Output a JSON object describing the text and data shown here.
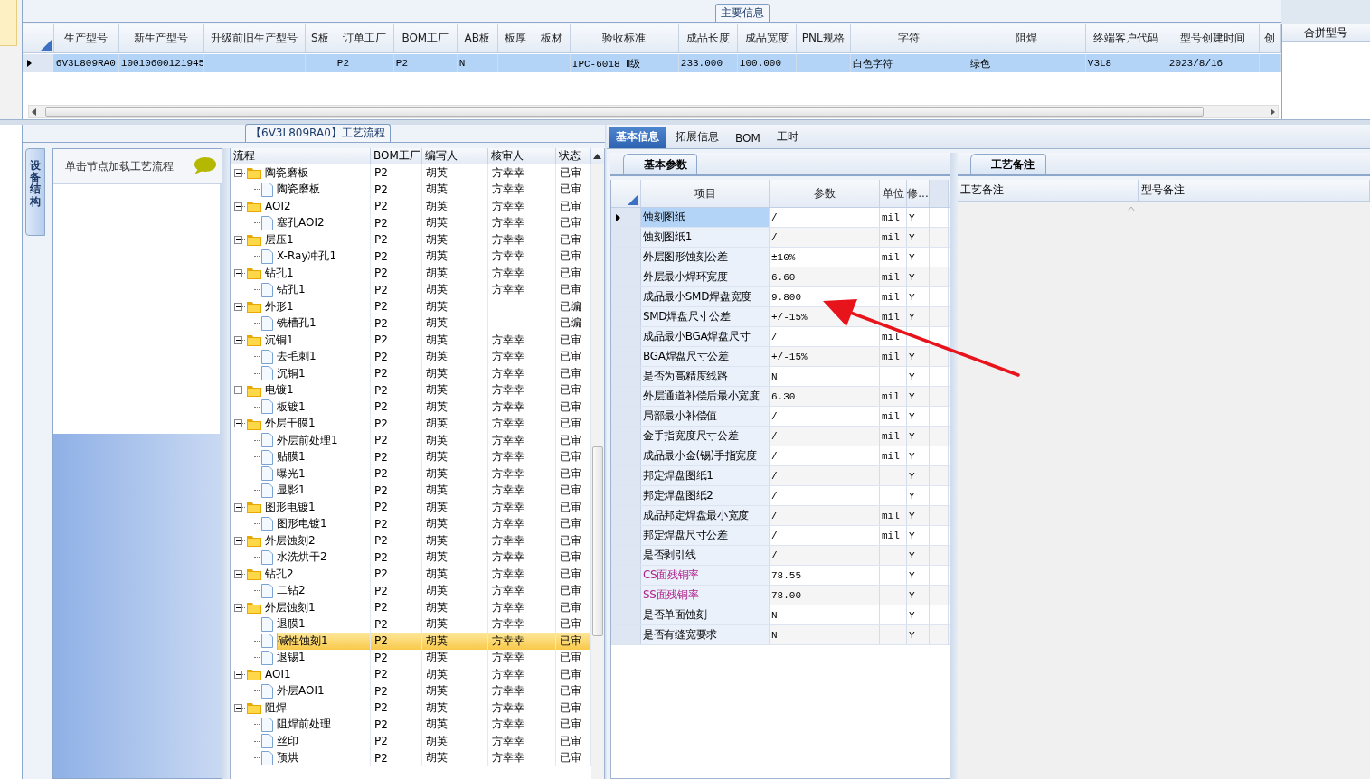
{
  "main_info": {
    "title": "主要信息",
    "columns": [
      "生产型号",
      "新生产型号",
      "升级前旧生产型号",
      "S板",
      "订单工厂",
      "BOM工厂",
      "AB板",
      "板厚",
      "板材",
      "验收标准",
      "成品长度",
      "成品宽度",
      "PNL规格",
      "字符",
      "阻焊",
      "终端客户代码",
      "型号创建时间",
      "创"
    ],
    "rows": [
      {
        "selected": true,
        "cells": [
          "6V3L809RA0",
          "10010600121945",
          null,
          null,
          "P2",
          "P2",
          "N",
          null,
          null,
          "IPC-6018 Ⅱ级",
          "233.000",
          "100.000",
          null,
          "白色字符",
          "绿色",
          "V3L8",
          "2023/8/16",
          null
        ]
      }
    ]
  },
  "merge_panel": {
    "title": "合拼型号"
  },
  "flow": {
    "title": "【6V3L809RA0】工艺流程",
    "side_tab": "设备结构",
    "hint": "单击节点加载工艺流程",
    "columns": [
      "流程",
      "BOM工厂",
      "编写人",
      "核审人",
      "状态"
    ],
    "nodes": [
      {
        "kind": "folder",
        "label": "陶瓷磨板",
        "bom": "P2",
        "writer": "胡英",
        "reviewer": "方幸幸",
        "status": "已审",
        "selected": false,
        "expanded": true,
        "children": [
          {
            "kind": "file",
            "label": "陶瓷磨板",
            "bom": "P2",
            "writer": "胡英",
            "reviewer": "方幸幸",
            "status": "已审",
            "selected": false
          }
        ]
      },
      {
        "kind": "folder",
        "label": "AOI2",
        "bom": "P2",
        "writer": "胡英",
        "reviewer": "方幸幸",
        "status": "已审",
        "selected": false,
        "expanded": true,
        "children": [
          {
            "kind": "file",
            "label": "塞孔AOI2",
            "bom": "P2",
            "writer": "胡英",
            "reviewer": "方幸幸",
            "status": "已审",
            "selected": false
          }
        ]
      },
      {
        "kind": "folder",
        "label": "层压1",
        "bom": "P2",
        "writer": "胡英",
        "reviewer": "方幸幸",
        "status": "已审",
        "selected": false,
        "expanded": true,
        "children": [
          {
            "kind": "file",
            "label": "X-Ray冲孔1",
            "bom": "P2",
            "writer": "胡英",
            "reviewer": "方幸幸",
            "status": "已审",
            "selected": false
          }
        ]
      },
      {
        "kind": "folder",
        "label": "钻孔1",
        "bom": "P2",
        "writer": "胡英",
        "reviewer": "方幸幸",
        "status": "已审",
        "selected": false,
        "expanded": true,
        "children": [
          {
            "kind": "file",
            "label": "钻孔1",
            "bom": "P2",
            "writer": "胡英",
            "reviewer": "方幸幸",
            "status": "已审",
            "selected": false
          }
        ]
      },
      {
        "kind": "folder",
        "label": "外形1",
        "bom": "P2",
        "writer": "胡英",
        "status": "已编",
        "selected": false,
        "expanded": true,
        "children": [
          {
            "kind": "file",
            "label": "铣槽孔1",
            "bom": "P2",
            "writer": "胡英",
            "status": "已编",
            "selected": false
          }
        ]
      },
      {
        "kind": "folder",
        "label": "沉铜1",
        "bom": "P2",
        "writer": "胡英",
        "reviewer": "方幸幸",
        "status": "已审",
        "selected": false,
        "expanded": true,
        "children": [
          {
            "kind": "file",
            "label": "去毛刺1",
            "bom": "P2",
            "writer": "胡英",
            "reviewer": "方幸幸",
            "status": "已审",
            "selected": false
          },
          {
            "kind": "file",
            "label": "沉铜1",
            "bom": "P2",
            "writer": "胡英",
            "reviewer": "方幸幸",
            "status": "已审",
            "selected": false
          }
        ]
      },
      {
        "kind": "folder",
        "label": "电镀1",
        "bom": "P2",
        "writer": "胡英",
        "reviewer": "方幸幸",
        "status": "已审",
        "selected": false,
        "expanded": true,
        "children": [
          {
            "kind": "file",
            "label": "板镀1",
            "bom": "P2",
            "writer": "胡英",
            "reviewer": "方幸幸",
            "status": "已审",
            "selected": false
          }
        ]
      },
      {
        "kind": "folder",
        "label": "外层干膜1",
        "bom": "P2",
        "writer": "胡英",
        "reviewer": "方幸幸",
        "status": "已审",
        "selected": false,
        "expanded": true,
        "children": [
          {
            "kind": "file",
            "label": "外层前处理1",
            "bom": "P2",
            "writer": "胡英",
            "reviewer": "方幸幸",
            "status": "已审",
            "selected": false
          },
          {
            "kind": "file",
            "label": "贴膜1",
            "bom": "P2",
            "writer": "胡英",
            "reviewer": "方幸幸",
            "status": "已审",
            "selected": false
          },
          {
            "kind": "file",
            "label": "曝光1",
            "bom": "P2",
            "writer": "胡英",
            "reviewer": "方幸幸",
            "status": "已审",
            "selected": false
          },
          {
            "kind": "file",
            "label": "显影1",
            "bom": "P2",
            "writer": "胡英",
            "reviewer": "方幸幸",
            "status": "已审",
            "selected": false
          }
        ]
      },
      {
        "kind": "folder",
        "label": "图形电镀1",
        "bom": "P2",
        "writer": "胡英",
        "reviewer": "方幸幸",
        "status": "已审",
        "selected": false,
        "expanded": true,
        "children": [
          {
            "kind": "file",
            "label": "图形电镀1",
            "bom": "P2",
            "writer": "胡英",
            "reviewer": "方幸幸",
            "status": "已审",
            "selected": false
          }
        ]
      },
      {
        "kind": "folder",
        "label": "外层蚀刻2",
        "bom": "P2",
        "writer": "胡英",
        "reviewer": "方幸幸",
        "status": "已审",
        "selected": false,
        "expanded": true,
        "children": [
          {
            "kind": "file",
            "label": "水洗烘干2",
            "bom": "P2",
            "writer": "胡英",
            "reviewer": "方幸幸",
            "status": "已审",
            "selected": false
          }
        ]
      },
      {
        "kind": "folder",
        "label": "钻孔2",
        "bom": "P2",
        "writer": "胡英",
        "reviewer": "方幸幸",
        "status": "已审",
        "selected": false,
        "expanded": true,
        "children": [
          {
            "kind": "file",
            "label": "二钻2",
            "bom": "P2",
            "writer": "胡英",
            "reviewer": "方幸幸",
            "status": "已审",
            "selected": false
          }
        ]
      },
      {
        "kind": "folder",
        "label": "外层蚀刻1",
        "bom": "P2",
        "writer": "胡英",
        "reviewer": "方幸幸",
        "status": "已审",
        "selected": false,
        "expanded": true,
        "children": [
          {
            "kind": "file",
            "label": "退膜1",
            "bom": "P2",
            "writer": "胡英",
            "reviewer": "方幸幸",
            "status": "已审",
            "selected": false
          },
          {
            "kind": "file",
            "label": "碱性蚀刻1",
            "bom": "P2",
            "writer": "胡英",
            "reviewer": "方幸幸",
            "status": "已审",
            "selected": true
          },
          {
            "kind": "file",
            "label": "退锡1",
            "bom": "P2",
            "writer": "胡英",
            "reviewer": "方幸幸",
            "status": "已审",
            "selected": false
          }
        ]
      },
      {
        "kind": "folder",
        "label": "AOI1",
        "bom": "P2",
        "writer": "胡英",
        "reviewer": "方幸幸",
        "status": "已审",
        "selected": false,
        "expanded": true,
        "children": [
          {
            "kind": "file",
            "label": "外层AOI1",
            "bom": "P2",
            "writer": "胡英",
            "reviewer": "方幸幸",
            "status": "已审",
            "selected": false
          }
        ]
      },
      {
        "kind": "folder",
        "label": "阻焊",
        "bom": "P2",
        "writer": "胡英",
        "reviewer": "方幸幸",
        "status": "已审",
        "selected": false,
        "expanded": true,
        "children": [
          {
            "kind": "file",
            "label": "阻焊前处理",
            "bom": "P2",
            "writer": "胡英",
            "reviewer": "方幸幸",
            "status": "已审",
            "selected": false
          },
          {
            "kind": "file",
            "label": "丝印",
            "bom": "P2",
            "writer": "胡英",
            "reviewer": "方幸幸",
            "status": "已审",
            "selected": false
          },
          {
            "kind": "file",
            "label": "预烘",
            "bom": "P2",
            "writer": "胡英",
            "reviewer": "方幸幸",
            "status": "已审",
            "selected": false
          }
        ]
      }
    ]
  },
  "detail": {
    "tabs": [
      {
        "label": "基本信息",
        "selected": true
      },
      {
        "label": "拓展信息",
        "selected": false
      },
      {
        "label": "BOM",
        "selected": false
      },
      {
        "label": "工时",
        "selected": false
      }
    ],
    "params": {
      "tab": "基本参数",
      "columns": [
        "项目",
        "参数",
        "单位",
        "修..."
      ],
      "rows": [
        {
          "item": "蚀刻图纸",
          "value": "/",
          "unit": "mil",
          "flag": "Y",
          "selected": true,
          "flagged": false
        },
        {
          "item": "蚀刻图纸1",
          "value": "/",
          "unit": "mil",
          "flag": "Y",
          "selected": false,
          "flagged": false
        },
        {
          "item": "外层图形蚀刻公差",
          "value": "±10%",
          "unit": "mil",
          "flag": "Y",
          "selected": false,
          "flagged": false
        },
        {
          "item": "外层最小焊环宽度",
          "value": "6.60",
          "unit": "mil",
          "flag": "Y",
          "selected": false,
          "flagged": false
        },
        {
          "item": "成品最小SMD焊盘宽度",
          "value": "9.800",
          "unit": "mil",
          "flag": "Y",
          "selected": false,
          "flagged": false
        },
        {
          "item": "SMD焊盘尺寸公差",
          "value": "+/-15%",
          "unit": "mil",
          "flag": "Y",
          "selected": false,
          "flagged": false
        },
        {
          "item": "成品最小BGA焊盘尺寸",
          "value": "/",
          "unit": "mil",
          "selected": false,
          "flagged": false
        },
        {
          "item": "BGA焊盘尺寸公差",
          "value": "+/-15%",
          "unit": "mil",
          "flag": "Y",
          "selected": false,
          "flagged": false
        },
        {
          "item": "是否为高精度线路",
          "value": "N",
          "flag": "Y",
          "selected": false,
          "flagged": false
        },
        {
          "item": "外层通道补偿后最小宽度",
          "value": "6.30",
          "unit": "mil",
          "flag": "Y",
          "selected": false,
          "flagged": false
        },
        {
          "item": "局部最小补偿值",
          "value": "/",
          "unit": "mil",
          "flag": "Y",
          "selected": false,
          "flagged": false
        },
        {
          "item": "金手指宽度尺寸公差",
          "value": "/",
          "unit": "mil",
          "flag": "Y",
          "selected": false,
          "flagged": false
        },
        {
          "item": "成品最小金(锡)手指宽度",
          "value": "/",
          "unit": "mil",
          "flag": "Y",
          "selected": false,
          "flagged": false
        },
        {
          "item": "邦定焊盘图纸1",
          "value": "/",
          "flag": "Y",
          "selected": false,
          "flagged": false
        },
        {
          "item": "邦定焊盘图纸2",
          "value": "/",
          "flag": "Y",
          "selected": false,
          "flagged": false
        },
        {
          "item": "成品邦定焊盘最小宽度",
          "value": "/",
          "unit": "mil",
          "flag": "Y",
          "selected": false,
          "flagged": false
        },
        {
          "item": "邦定焊盘尺寸公差",
          "value": "/",
          "unit": "mil",
          "flag": "Y",
          "selected": false,
          "flagged": false
        },
        {
          "item": "是否剥引线",
          "value": "/",
          "flag": "Y",
          "selected": false,
          "flagged": false
        },
        {
          "item": "CS面残铜率",
          "value": "78.55",
          "flag": "Y",
          "selected": false,
          "flagged": true
        },
        {
          "item": "SS面残铜率",
          "value": "78.00",
          "flag": "Y",
          "selected": false,
          "flagged": true
        },
        {
          "item": "是否单面蚀刻",
          "value": "N",
          "flag": "Y",
          "selected": false,
          "flagged": false
        },
        {
          "item": "是否有缝宽要求",
          "value": "N",
          "flag": "Y",
          "selected": false,
          "flagged": false
        }
      ]
    },
    "notes": {
      "tab": "工艺备注",
      "columns": [
        "工艺备注",
        "型号备注"
      ]
    }
  },
  "overlay": {
    "kind": "arrow"
  }
}
